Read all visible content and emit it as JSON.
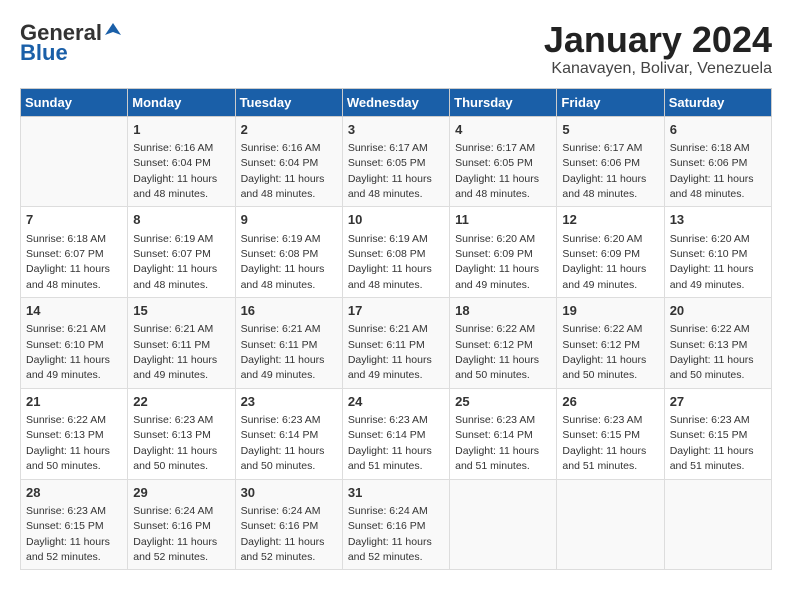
{
  "logo": {
    "general": "General",
    "blue": "Blue"
  },
  "title": "January 2024",
  "location": "Kanavayen, Bolivar, Venezuela",
  "days_of_week": [
    "Sunday",
    "Monday",
    "Tuesday",
    "Wednesday",
    "Thursday",
    "Friday",
    "Saturday"
  ],
  "weeks": [
    [
      {
        "day": "",
        "sunrise": "",
        "sunset": "",
        "daylight": ""
      },
      {
        "day": "1",
        "sunrise": "Sunrise: 6:16 AM",
        "sunset": "Sunset: 6:04 PM",
        "daylight": "Daylight: 11 hours and 48 minutes."
      },
      {
        "day": "2",
        "sunrise": "Sunrise: 6:16 AM",
        "sunset": "Sunset: 6:04 PM",
        "daylight": "Daylight: 11 hours and 48 minutes."
      },
      {
        "day": "3",
        "sunrise": "Sunrise: 6:17 AM",
        "sunset": "Sunset: 6:05 PM",
        "daylight": "Daylight: 11 hours and 48 minutes."
      },
      {
        "day": "4",
        "sunrise": "Sunrise: 6:17 AM",
        "sunset": "Sunset: 6:05 PM",
        "daylight": "Daylight: 11 hours and 48 minutes."
      },
      {
        "day": "5",
        "sunrise": "Sunrise: 6:17 AM",
        "sunset": "Sunset: 6:06 PM",
        "daylight": "Daylight: 11 hours and 48 minutes."
      },
      {
        "day": "6",
        "sunrise": "Sunrise: 6:18 AM",
        "sunset": "Sunset: 6:06 PM",
        "daylight": "Daylight: 11 hours and 48 minutes."
      }
    ],
    [
      {
        "day": "7",
        "sunrise": "Sunrise: 6:18 AM",
        "sunset": "Sunset: 6:07 PM",
        "daylight": "Daylight: 11 hours and 48 minutes."
      },
      {
        "day": "8",
        "sunrise": "Sunrise: 6:19 AM",
        "sunset": "Sunset: 6:07 PM",
        "daylight": "Daylight: 11 hours and 48 minutes."
      },
      {
        "day": "9",
        "sunrise": "Sunrise: 6:19 AM",
        "sunset": "Sunset: 6:08 PM",
        "daylight": "Daylight: 11 hours and 48 minutes."
      },
      {
        "day": "10",
        "sunrise": "Sunrise: 6:19 AM",
        "sunset": "Sunset: 6:08 PM",
        "daylight": "Daylight: 11 hours and 48 minutes."
      },
      {
        "day": "11",
        "sunrise": "Sunrise: 6:20 AM",
        "sunset": "Sunset: 6:09 PM",
        "daylight": "Daylight: 11 hours and 49 minutes."
      },
      {
        "day": "12",
        "sunrise": "Sunrise: 6:20 AM",
        "sunset": "Sunset: 6:09 PM",
        "daylight": "Daylight: 11 hours and 49 minutes."
      },
      {
        "day": "13",
        "sunrise": "Sunrise: 6:20 AM",
        "sunset": "Sunset: 6:10 PM",
        "daylight": "Daylight: 11 hours and 49 minutes."
      }
    ],
    [
      {
        "day": "14",
        "sunrise": "Sunrise: 6:21 AM",
        "sunset": "Sunset: 6:10 PM",
        "daylight": "Daylight: 11 hours and 49 minutes."
      },
      {
        "day": "15",
        "sunrise": "Sunrise: 6:21 AM",
        "sunset": "Sunset: 6:11 PM",
        "daylight": "Daylight: 11 hours and 49 minutes."
      },
      {
        "day": "16",
        "sunrise": "Sunrise: 6:21 AM",
        "sunset": "Sunset: 6:11 PM",
        "daylight": "Daylight: 11 hours and 49 minutes."
      },
      {
        "day": "17",
        "sunrise": "Sunrise: 6:21 AM",
        "sunset": "Sunset: 6:11 PM",
        "daylight": "Daylight: 11 hours and 49 minutes."
      },
      {
        "day": "18",
        "sunrise": "Sunrise: 6:22 AM",
        "sunset": "Sunset: 6:12 PM",
        "daylight": "Daylight: 11 hours and 50 minutes."
      },
      {
        "day": "19",
        "sunrise": "Sunrise: 6:22 AM",
        "sunset": "Sunset: 6:12 PM",
        "daylight": "Daylight: 11 hours and 50 minutes."
      },
      {
        "day": "20",
        "sunrise": "Sunrise: 6:22 AM",
        "sunset": "Sunset: 6:13 PM",
        "daylight": "Daylight: 11 hours and 50 minutes."
      }
    ],
    [
      {
        "day": "21",
        "sunrise": "Sunrise: 6:22 AM",
        "sunset": "Sunset: 6:13 PM",
        "daylight": "Daylight: 11 hours and 50 minutes."
      },
      {
        "day": "22",
        "sunrise": "Sunrise: 6:23 AM",
        "sunset": "Sunset: 6:13 PM",
        "daylight": "Daylight: 11 hours and 50 minutes."
      },
      {
        "day": "23",
        "sunrise": "Sunrise: 6:23 AM",
        "sunset": "Sunset: 6:14 PM",
        "daylight": "Daylight: 11 hours and 50 minutes."
      },
      {
        "day": "24",
        "sunrise": "Sunrise: 6:23 AM",
        "sunset": "Sunset: 6:14 PM",
        "daylight": "Daylight: 11 hours and 51 minutes."
      },
      {
        "day": "25",
        "sunrise": "Sunrise: 6:23 AM",
        "sunset": "Sunset: 6:14 PM",
        "daylight": "Daylight: 11 hours and 51 minutes."
      },
      {
        "day": "26",
        "sunrise": "Sunrise: 6:23 AM",
        "sunset": "Sunset: 6:15 PM",
        "daylight": "Daylight: 11 hours and 51 minutes."
      },
      {
        "day": "27",
        "sunrise": "Sunrise: 6:23 AM",
        "sunset": "Sunset: 6:15 PM",
        "daylight": "Daylight: 11 hours and 51 minutes."
      }
    ],
    [
      {
        "day": "28",
        "sunrise": "Sunrise: 6:23 AM",
        "sunset": "Sunset: 6:15 PM",
        "daylight": "Daylight: 11 hours and 52 minutes."
      },
      {
        "day": "29",
        "sunrise": "Sunrise: 6:24 AM",
        "sunset": "Sunset: 6:16 PM",
        "daylight": "Daylight: 11 hours and 52 minutes."
      },
      {
        "day": "30",
        "sunrise": "Sunrise: 6:24 AM",
        "sunset": "Sunset: 6:16 PM",
        "daylight": "Daylight: 11 hours and 52 minutes."
      },
      {
        "day": "31",
        "sunrise": "Sunrise: 6:24 AM",
        "sunset": "Sunset: 6:16 PM",
        "daylight": "Daylight: 11 hours and 52 minutes."
      },
      {
        "day": "",
        "sunrise": "",
        "sunset": "",
        "daylight": ""
      },
      {
        "day": "",
        "sunrise": "",
        "sunset": "",
        "daylight": ""
      },
      {
        "day": "",
        "sunrise": "",
        "sunset": "",
        "daylight": ""
      }
    ]
  ]
}
